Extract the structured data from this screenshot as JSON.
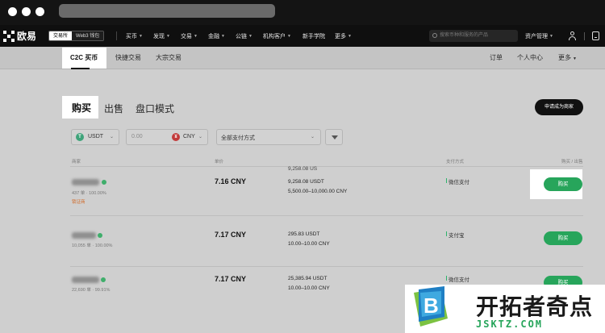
{
  "nav": {
    "logo": "欧易",
    "mode_tabs": [
      "交易所",
      "Web3 钱包"
    ],
    "items": [
      "买币",
      "发现",
      "交易",
      "金融",
      "公链",
      "机构客户",
      "新手学院",
      "更多"
    ],
    "search_placeholder": "搜索币种和服务的产品",
    "asset_label": "资产管理"
  },
  "subnav": {
    "tabs": [
      "C2C 买币",
      "快捷交易",
      "大宗交易"
    ],
    "right": [
      "订单",
      "个人中心",
      "更多"
    ]
  },
  "page": {
    "tabs": [
      "购买",
      "出售",
      "盘口模式"
    ],
    "merchant_button": "申请成为商家"
  },
  "filters": {
    "coin": "USDT",
    "amount_placeholder": "0.00",
    "fiat": "CNY",
    "payment": "全部支付方式"
  },
  "table": {
    "headers": [
      "商家",
      "单价",
      "",
      "支付方式",
      "购买 / 出售"
    ],
    "rows": [
      {
        "name": "佑兴商户",
        "stats": "437 单 · 100.00%",
        "badge": "锁证商",
        "price": "7.16 CNY",
        "amount_top": "9,258.08 US",
        "amount": "9,258.08 USDT",
        "limit": "5,500.00–10,000.00 CNY",
        "payment": "微信支付",
        "button": "购买"
      },
      {
        "name": "上海商户",
        "stats": "10,055 单 · 100.00%",
        "badge": "",
        "price": "7.17 CNY",
        "amount_top": "",
        "amount": "295.83 USDT",
        "limit": "10.00–10.00 CNY",
        "payment": "支付宝",
        "button": "购买"
      },
      {
        "name": "商户9991",
        "stats": "22,690 单 · 99.91%",
        "badge": "",
        "price": "7.17 CNY",
        "amount_top": "",
        "amount": "25,385.94 USDT",
        "limit": "10.00–10.00 CNY",
        "payment": "微信支付",
        "button": "购买"
      }
    ]
  },
  "watermark": {
    "logo_letter": "B",
    "name": "开拓者奇点",
    "url": "JSKTZ.COM"
  },
  "colors": {
    "accent_green": "#27a55b",
    "tether": "#3fa37a",
    "cny": "#c23b3b"
  }
}
